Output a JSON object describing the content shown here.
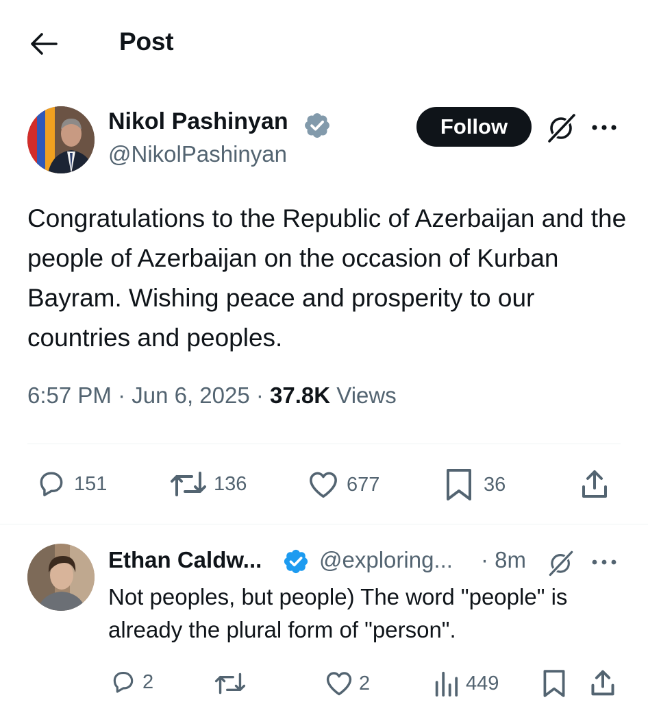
{
  "header": {
    "title": "Post",
    "back_icon": "arrow-left-icon"
  },
  "post": {
    "author_name": "Nikol Pashinyan",
    "author_handle": "@NikolPashinyan",
    "follow_label": "Follow",
    "text": "Congratulations to the Republic of Azerbaijan and the people of Azerbaijan on the occasion of Kurban Bayram. Wishing peace and prosperity to our countries and peoples.",
    "time": "6:57 PM",
    "date": "Jun 6, 2025",
    "views_count": "37.8K",
    "views_label": "Views",
    "replies": "151",
    "reposts": "136",
    "likes": "677",
    "bookmarks": "36"
  },
  "reply": {
    "author_name": "Ethan Caldw...",
    "author_handle": "@exploring...",
    "time": "· 8m",
    "text": "Not peoples, but people) The word \"people\" is already the plural form of \"person\".",
    "replies": "2",
    "likes": "2",
    "views": "449"
  },
  "colors": {
    "verified": "#1d9bf0",
    "text_primary": "#0f1419",
    "text_secondary": "#536471",
    "follow_bg": "#0f1419"
  }
}
